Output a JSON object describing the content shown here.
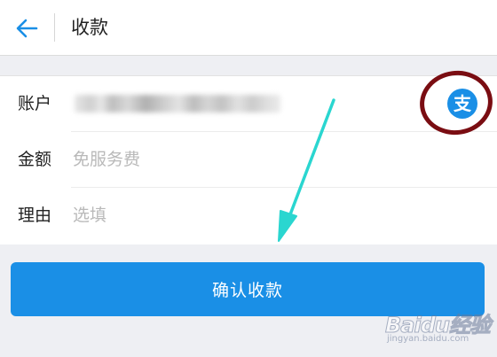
{
  "header": {
    "title": "收款",
    "back_icon": "arrow-left-icon"
  },
  "form": {
    "account_label": "账户",
    "amount_label": "金额",
    "amount_placeholder": "免服务费",
    "reason_label": "理由",
    "reason_placeholder": "选填"
  },
  "alipay": {
    "glyph": "支",
    "color": "#1a8fe6"
  },
  "confirm_button": {
    "label": "确认收款"
  },
  "watermark": {
    "brand": "Baidu经验",
    "domain": "jingyan.baidu.com"
  },
  "colors": {
    "accent": "#1a8fe6",
    "annotation_circle": "#7a0d12",
    "annotation_arrow": "#2ad6d0"
  }
}
